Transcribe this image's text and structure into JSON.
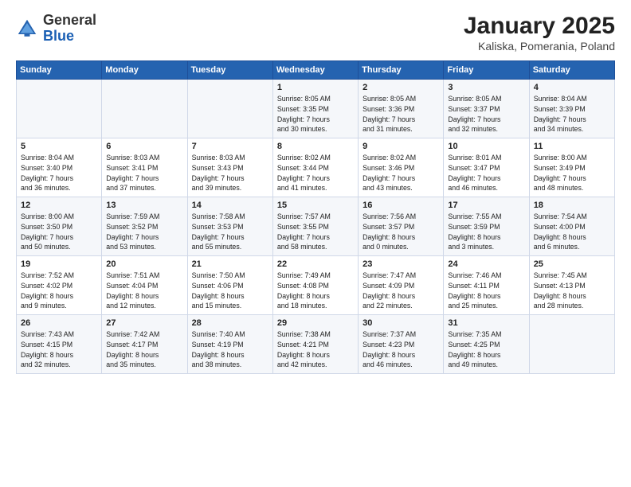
{
  "header": {
    "logo_general": "General",
    "logo_blue": "Blue",
    "title": "January 2025",
    "subtitle": "Kaliska, Pomerania, Poland"
  },
  "weekdays": [
    "Sunday",
    "Monday",
    "Tuesday",
    "Wednesday",
    "Thursday",
    "Friday",
    "Saturday"
  ],
  "weeks": [
    [
      {
        "day": "",
        "info": ""
      },
      {
        "day": "",
        "info": ""
      },
      {
        "day": "",
        "info": ""
      },
      {
        "day": "1",
        "info": "Sunrise: 8:05 AM\nSunset: 3:35 PM\nDaylight: 7 hours\nand 30 minutes."
      },
      {
        "day": "2",
        "info": "Sunrise: 8:05 AM\nSunset: 3:36 PM\nDaylight: 7 hours\nand 31 minutes."
      },
      {
        "day": "3",
        "info": "Sunrise: 8:05 AM\nSunset: 3:37 PM\nDaylight: 7 hours\nand 32 minutes."
      },
      {
        "day": "4",
        "info": "Sunrise: 8:04 AM\nSunset: 3:39 PM\nDaylight: 7 hours\nand 34 minutes."
      }
    ],
    [
      {
        "day": "5",
        "info": "Sunrise: 8:04 AM\nSunset: 3:40 PM\nDaylight: 7 hours\nand 36 minutes."
      },
      {
        "day": "6",
        "info": "Sunrise: 8:03 AM\nSunset: 3:41 PM\nDaylight: 7 hours\nand 37 minutes."
      },
      {
        "day": "7",
        "info": "Sunrise: 8:03 AM\nSunset: 3:43 PM\nDaylight: 7 hours\nand 39 minutes."
      },
      {
        "day": "8",
        "info": "Sunrise: 8:02 AM\nSunset: 3:44 PM\nDaylight: 7 hours\nand 41 minutes."
      },
      {
        "day": "9",
        "info": "Sunrise: 8:02 AM\nSunset: 3:46 PM\nDaylight: 7 hours\nand 43 minutes."
      },
      {
        "day": "10",
        "info": "Sunrise: 8:01 AM\nSunset: 3:47 PM\nDaylight: 7 hours\nand 46 minutes."
      },
      {
        "day": "11",
        "info": "Sunrise: 8:00 AM\nSunset: 3:49 PM\nDaylight: 7 hours\nand 48 minutes."
      }
    ],
    [
      {
        "day": "12",
        "info": "Sunrise: 8:00 AM\nSunset: 3:50 PM\nDaylight: 7 hours\nand 50 minutes."
      },
      {
        "day": "13",
        "info": "Sunrise: 7:59 AM\nSunset: 3:52 PM\nDaylight: 7 hours\nand 53 minutes."
      },
      {
        "day": "14",
        "info": "Sunrise: 7:58 AM\nSunset: 3:53 PM\nDaylight: 7 hours\nand 55 minutes."
      },
      {
        "day": "15",
        "info": "Sunrise: 7:57 AM\nSunset: 3:55 PM\nDaylight: 7 hours\nand 58 minutes."
      },
      {
        "day": "16",
        "info": "Sunrise: 7:56 AM\nSunset: 3:57 PM\nDaylight: 8 hours\nand 0 minutes."
      },
      {
        "day": "17",
        "info": "Sunrise: 7:55 AM\nSunset: 3:59 PM\nDaylight: 8 hours\nand 3 minutes."
      },
      {
        "day": "18",
        "info": "Sunrise: 7:54 AM\nSunset: 4:00 PM\nDaylight: 8 hours\nand 6 minutes."
      }
    ],
    [
      {
        "day": "19",
        "info": "Sunrise: 7:52 AM\nSunset: 4:02 PM\nDaylight: 8 hours\nand 9 minutes."
      },
      {
        "day": "20",
        "info": "Sunrise: 7:51 AM\nSunset: 4:04 PM\nDaylight: 8 hours\nand 12 minutes."
      },
      {
        "day": "21",
        "info": "Sunrise: 7:50 AM\nSunset: 4:06 PM\nDaylight: 8 hours\nand 15 minutes."
      },
      {
        "day": "22",
        "info": "Sunrise: 7:49 AM\nSunset: 4:08 PM\nDaylight: 8 hours\nand 18 minutes."
      },
      {
        "day": "23",
        "info": "Sunrise: 7:47 AM\nSunset: 4:09 PM\nDaylight: 8 hours\nand 22 minutes."
      },
      {
        "day": "24",
        "info": "Sunrise: 7:46 AM\nSunset: 4:11 PM\nDaylight: 8 hours\nand 25 minutes."
      },
      {
        "day": "25",
        "info": "Sunrise: 7:45 AM\nSunset: 4:13 PM\nDaylight: 8 hours\nand 28 minutes."
      }
    ],
    [
      {
        "day": "26",
        "info": "Sunrise: 7:43 AM\nSunset: 4:15 PM\nDaylight: 8 hours\nand 32 minutes."
      },
      {
        "day": "27",
        "info": "Sunrise: 7:42 AM\nSunset: 4:17 PM\nDaylight: 8 hours\nand 35 minutes."
      },
      {
        "day": "28",
        "info": "Sunrise: 7:40 AM\nSunset: 4:19 PM\nDaylight: 8 hours\nand 38 minutes."
      },
      {
        "day": "29",
        "info": "Sunrise: 7:38 AM\nSunset: 4:21 PM\nDaylight: 8 hours\nand 42 minutes."
      },
      {
        "day": "30",
        "info": "Sunrise: 7:37 AM\nSunset: 4:23 PM\nDaylight: 8 hours\nand 46 minutes."
      },
      {
        "day": "31",
        "info": "Sunrise: 7:35 AM\nSunset: 4:25 PM\nDaylight: 8 hours\nand 49 minutes."
      },
      {
        "day": "",
        "info": ""
      }
    ]
  ]
}
